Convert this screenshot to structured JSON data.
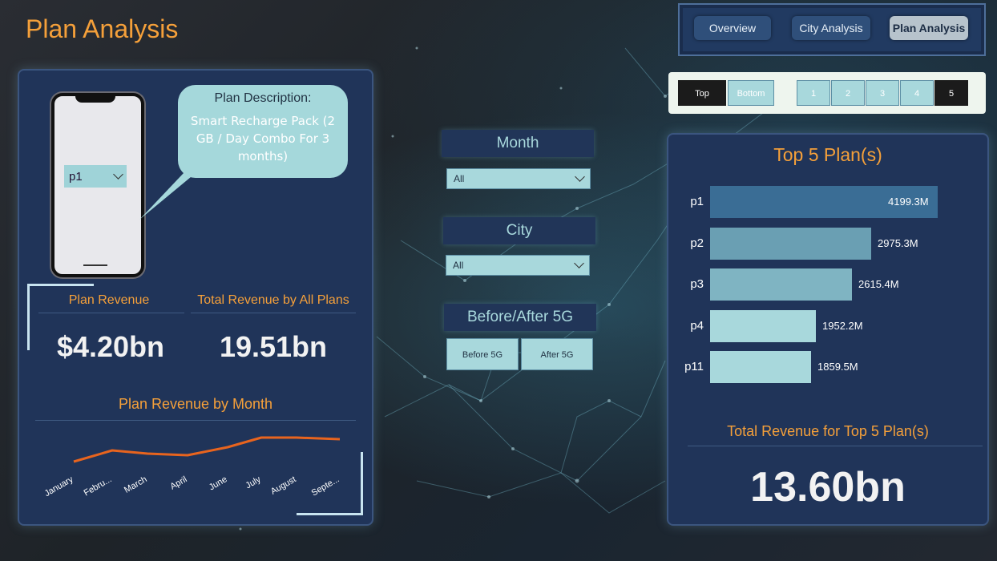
{
  "page": {
    "title": "Plan Analysis"
  },
  "nav": {
    "items": [
      "Overview",
      "City Analysis",
      "Plan Analysis"
    ],
    "active": "Plan Analysis"
  },
  "ranking": {
    "top_label": "Top",
    "bottom_label": "Bottom",
    "counts": [
      "1",
      "2",
      "3",
      "4",
      "5"
    ],
    "selected_mode": "Top",
    "selected_count": "5"
  },
  "plan_card": {
    "selected_plan": "p1",
    "description_title": "Plan Description:",
    "description_text": "Smart Recharge Pack (2 GB / Day Combo For 3 months)"
  },
  "kpis": {
    "plan_revenue_label": "Plan Revenue",
    "plan_revenue_value": "$4.20bn",
    "total_revenue_label": "Total Revenue by All Plans",
    "total_revenue_value": "19.51bn"
  },
  "filters": {
    "month_label": "Month",
    "month_value": "All",
    "city_label": "City",
    "city_value": "All",
    "fiveg_label": "Before/After 5G",
    "fiveg_options": [
      "Before 5G",
      "After 5G"
    ]
  },
  "month_chart": {
    "title": "Plan Revenue by Month",
    "tick_labels": [
      "January",
      "Febru...",
      "March",
      "April",
      "June",
      "July",
      "August",
      "Septe..."
    ],
    "series_color": "#e8641e"
  },
  "chart_data": {
    "type": "bar",
    "title": "Top 5 Plan(s)",
    "categories": [
      "p1",
      "p2",
      "p3",
      "p4",
      "p11"
    ],
    "values": [
      4199.3,
      2975.3,
      2615.4,
      1952.2,
      1859.5
    ],
    "value_labels": [
      "4199.3M",
      "2975.3M",
      "2615.4M",
      "1952.2M",
      "1859.5M"
    ],
    "colors": [
      "#3a6d95",
      "#6a9fb3",
      "#7fb4c2",
      "#a8d8dc",
      "#a8d8dc"
    ],
    "xlim": [
      0,
      4199.3
    ]
  },
  "top_total": {
    "label": "Total Revenue for Top 5 Plan(s)",
    "value": "13.60bn"
  }
}
